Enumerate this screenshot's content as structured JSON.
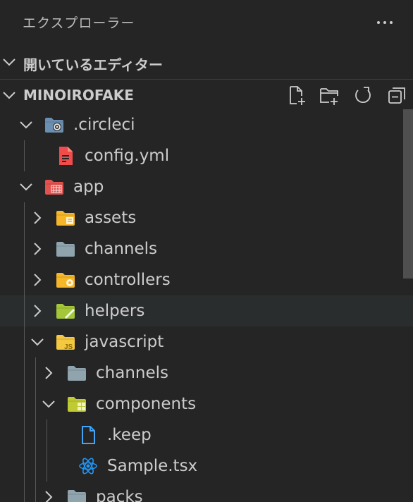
{
  "sidebar": {
    "title": "エクスプローラー",
    "open_editors_label": "開いているエディター",
    "project_name": "MINOIROFAKE",
    "toolbar": [
      "new-file",
      "new-folder",
      "refresh",
      "collapse-all"
    ]
  },
  "tree": [
    {
      "name": ".circleci",
      "kind": "folder",
      "expanded": true,
      "depth": 0,
      "icon": "circleci-folder-icon",
      "color": "#6b8fb0"
    },
    {
      "name": "config.yml",
      "kind": "file",
      "depth": 1,
      "icon": "yaml-file-icon",
      "color": "#f14c4c"
    },
    {
      "name": "app",
      "kind": "folder",
      "expanded": true,
      "depth": 0,
      "icon": "app-folder-icon",
      "color": "#e2524f"
    },
    {
      "name": "assets",
      "kind": "folder",
      "expanded": false,
      "depth": 1,
      "icon": "assets-folder-icon",
      "color": "#f5b62a"
    },
    {
      "name": "channels",
      "kind": "folder",
      "expanded": false,
      "depth": 1,
      "icon": "folder-icon",
      "color": "#90a4ae"
    },
    {
      "name": "controllers",
      "kind": "folder",
      "expanded": false,
      "depth": 1,
      "icon": "controllers-folder-icon",
      "color": "#f5b62a"
    },
    {
      "name": "helpers",
      "kind": "folder",
      "expanded": false,
      "depth": 1,
      "icon": "helpers-folder-icon",
      "color": "#a4c639",
      "hover": true
    },
    {
      "name": "javascript",
      "kind": "folder",
      "expanded": true,
      "depth": 1,
      "icon": "javascript-folder-icon",
      "color": "#f5c842"
    },
    {
      "name": "channels",
      "kind": "folder",
      "expanded": false,
      "depth": 2,
      "icon": "folder-icon",
      "color": "#90a4ae"
    },
    {
      "name": "components",
      "kind": "folder",
      "expanded": true,
      "depth": 2,
      "icon": "components-folder-icon",
      "color": "#c0ca33"
    },
    {
      "name": ".keep",
      "kind": "file",
      "depth": 3,
      "icon": "file-icon",
      "color": "#42a5f5"
    },
    {
      "name": "Sample.tsx",
      "kind": "file",
      "depth": 3,
      "icon": "react-icon",
      "color": "#2196f3"
    },
    {
      "name": "packs",
      "kind": "folder",
      "expanded": false,
      "depth": 2,
      "icon": "folder-icon",
      "color": "#90a4ae"
    }
  ]
}
